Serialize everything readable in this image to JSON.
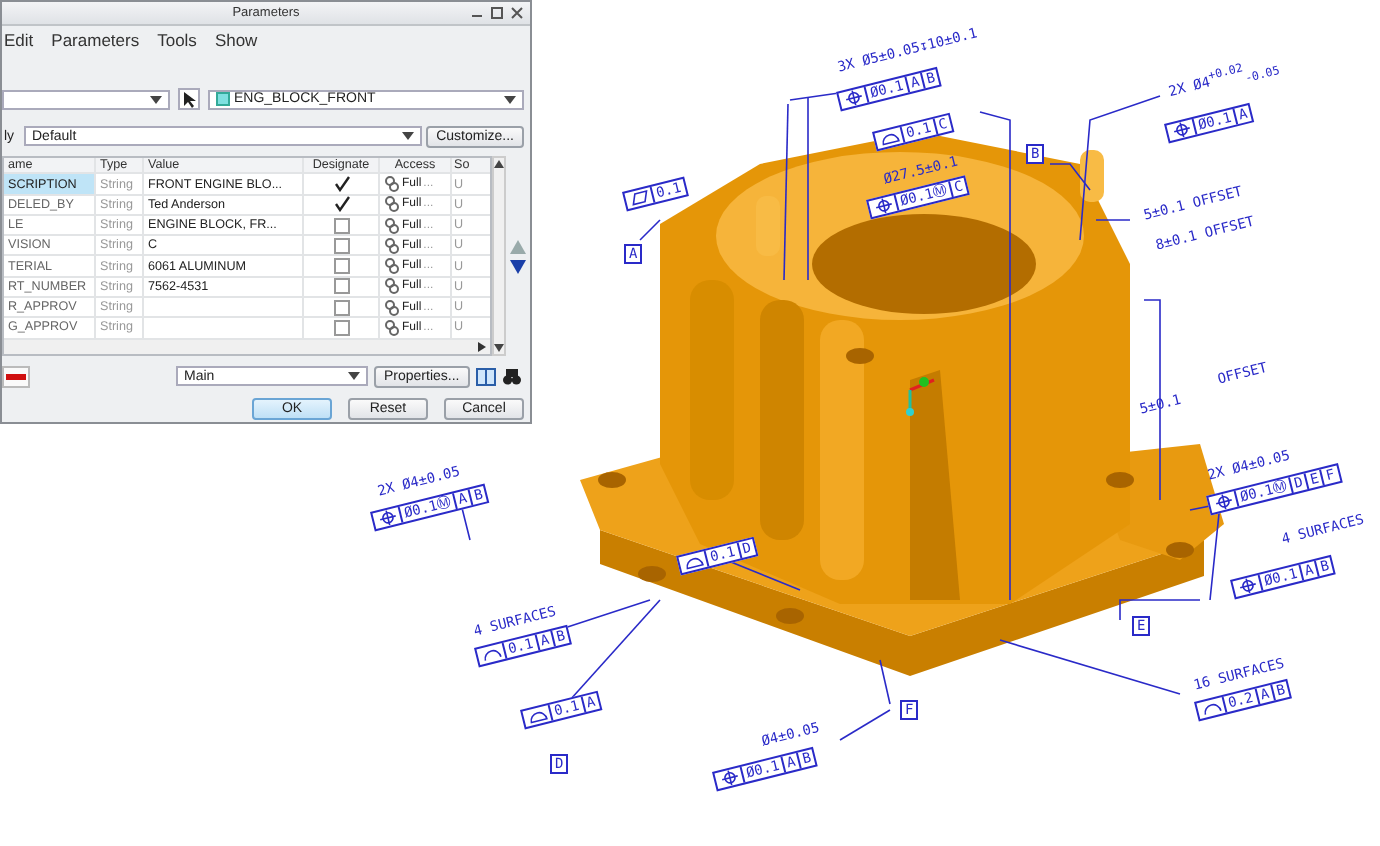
{
  "window": {
    "title": "Parameters"
  },
  "menu": [
    "Edit",
    "Parameters",
    "Tools",
    "Show"
  ],
  "look_in": {
    "model": "ENG_BLOCK_FRONT"
  },
  "filter": {
    "label": "ly",
    "value": "Default",
    "button": "Customize..."
  },
  "table": {
    "columns": [
      "ame",
      "Type",
      "Value",
      "Designate",
      "Access",
      "So"
    ],
    "rows": [
      {
        "name": "SCRIPTION",
        "type": "String",
        "value": "FRONT ENGINE BLO...",
        "designate": true,
        "access": "Full",
        "more": "...",
        "source": "U",
        "selected": true
      },
      {
        "name": "DELED_BY",
        "type": "String",
        "value": "Ted Anderson",
        "designate": true,
        "access": "Full",
        "more": "...",
        "source": "U",
        "selected": false
      },
      {
        "name": "LE",
        "type": "String",
        "value": "ENGINE BLOCK, FR...",
        "designate": false,
        "access": "Full",
        "more": "...",
        "source": "U",
        "selected": false
      },
      {
        "name": "VISION",
        "type": "String",
        "value": "C",
        "designate": false,
        "access": "Full",
        "more": "...",
        "source": "U",
        "selected": false
      },
      {
        "name": "TERIAL",
        "type": "String",
        "value": "6061 ALUMINUM",
        "designate": false,
        "access": "Full",
        "more": "...",
        "source": "U",
        "selected": false
      },
      {
        "name": "RT_NUMBER",
        "type": "String",
        "value": "7562-4531",
        "designate": false,
        "access": "Full",
        "more": "...",
        "source": "U",
        "selected": false
      },
      {
        "name": "R_APPROV",
        "type": "String",
        "value": "",
        "designate": false,
        "access": "Full",
        "more": "...",
        "source": "U",
        "selected": false
      },
      {
        "name": "G_APPROV",
        "type": "String",
        "value": "",
        "designate": false,
        "access": "Full",
        "more": "...",
        "source": "U",
        "selected": false
      }
    ]
  },
  "footer": {
    "set": "Main",
    "properties": "Properties..."
  },
  "buttons": [
    "OK",
    "Reset",
    "Cancel"
  ],
  "annotations": [
    {
      "kind": "dimension",
      "text": "3X Ø5±0.05↧10±0.1"
    },
    {
      "kind": "position",
      "cells": [
        "Ø0.1",
        "A",
        "B"
      ]
    },
    {
      "kind": "profile-surface",
      "cells": [
        "0.1",
        "C"
      ]
    },
    {
      "kind": "datum",
      "text": "B"
    },
    {
      "kind": "dimension",
      "text": "2X Ø4$^{+0.02}$$_{-0.05}$"
    },
    {
      "kind": "position",
      "cells": [
        "Ø0.1",
        "A"
      ]
    },
    {
      "kind": "dimension",
      "text": "5±0.1 OFFSET"
    },
    {
      "kind": "dimension",
      "text": "8±0.1 OFFSET"
    },
    {
      "kind": "dimension",
      "text": "Ø27.5±0.1"
    },
    {
      "kind": "position",
      "cells": [
        "Ø0.1Ⓜ",
        "C"
      ]
    },
    {
      "kind": "flatness",
      "cells": [
        "0.1"
      ]
    },
    {
      "kind": "datum",
      "text": "A"
    },
    {
      "kind": "dimension",
      "text": "5±0.1"
    },
    {
      "kind": "dimension",
      "text": "OFFSET"
    },
    {
      "kind": "dimension",
      "text": "2X Ø4±0.05"
    },
    {
      "kind": "position",
      "cells": [
        "Ø0.1Ⓜ",
        "D",
        "E",
        "F"
      ]
    },
    {
      "kind": "dimension",
      "text": "2X Ø4±0.05"
    },
    {
      "kind": "position",
      "cells": [
        "Ø0.1Ⓜ",
        "A",
        "B"
      ]
    },
    {
      "kind": "dimension",
      "text": "4 SURFACES"
    },
    {
      "kind": "position",
      "cells": [
        "Ø0.1",
        "A",
        "B"
      ]
    },
    {
      "kind": "datum",
      "text": "E"
    },
    {
      "kind": "profile-surface",
      "cells": [
        "0.1",
        "D"
      ]
    },
    {
      "kind": "dimension",
      "text": "4 SURFACES"
    },
    {
      "kind": "profile-line",
      "cells": [
        "0.1",
        "A",
        "B"
      ]
    },
    {
      "kind": "profile-surface",
      "cells": [
        "0.1",
        "A"
      ]
    },
    {
      "kind": "datum",
      "text": "D"
    },
    {
      "kind": "dimension",
      "text": "Ø4±0.05"
    },
    {
      "kind": "position",
      "cells": [
        "Ø0.1",
        "A",
        "B"
      ]
    },
    {
      "kind": "datum",
      "text": "F"
    },
    {
      "kind": "dimension",
      "text": "16 SURFACES"
    },
    {
      "kind": "profile-line",
      "cells": [
        "0.2",
        "A",
        "B"
      ]
    }
  ]
}
